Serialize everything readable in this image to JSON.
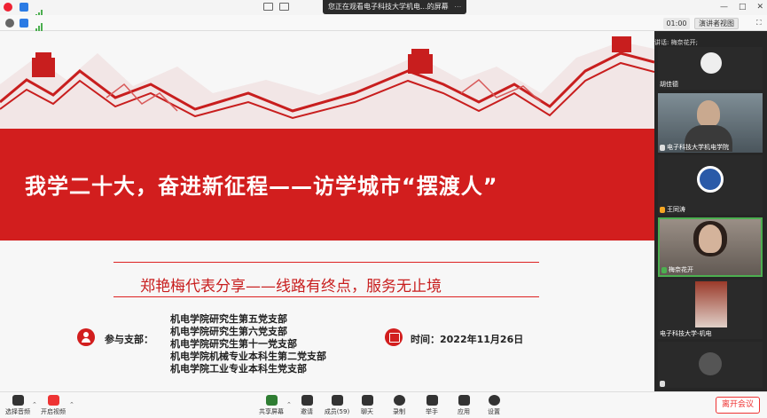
{
  "topbar": {
    "share_notice": "您正在观看电子科技大学机电...的屏幕",
    "dots": "⋯"
  },
  "toolbar": {
    "timer": "01:00",
    "view_mode": "演讲者视图"
  },
  "slide": {
    "title": "我学二十大，奋进新征程——访学城市“摆渡人”",
    "subtitle": "郑艳梅代表分享——线路有终点，服务无止境",
    "branch_label": "参与支部：",
    "branches": [
      "机电学院研究生第五党支部",
      "机电学院研究生第六党支部",
      "机电学院研究生第十一党支部",
      "机电学院机械专业本科生第二党支部",
      "机电学院工业专业本科生党支部"
    ],
    "time_label": "时间：2022年11月26日",
    "accent_color": "#d21e1e"
  },
  "panel": {
    "speaking_label": "讲话: 梅奈花开;",
    "tiles": [
      {
        "name": "胡佳德",
        "kind": "avatar"
      },
      {
        "name": "电子科技大学机电学院",
        "kind": "video"
      },
      {
        "name": "王同涛",
        "kind": "logo"
      },
      {
        "name": "梅奈花开",
        "kind": "video-active"
      },
      {
        "name": "电子科技大学-机电",
        "kind": "video"
      },
      {
        "name": "",
        "kind": "avatar"
      }
    ]
  },
  "bottombar": {
    "items": [
      {
        "label": "选择音频",
        "icon": "headphone-icon"
      },
      {
        "label": "开启视频",
        "icon": "video-off-icon"
      },
      {
        "label": "共享屏幕",
        "icon": "share-screen-icon"
      },
      {
        "label": "邀请",
        "icon": "invite-icon"
      },
      {
        "label": "成员(59)",
        "icon": "members-icon"
      },
      {
        "label": "聊天",
        "icon": "chat-icon"
      },
      {
        "label": "录制",
        "icon": "record-icon"
      },
      {
        "label": "举手",
        "icon": "raise-hand-icon"
      },
      {
        "label": "应用",
        "icon": "apps-icon"
      },
      {
        "label": "设置",
        "icon": "settings-icon"
      }
    ],
    "leave_label": "离开会议"
  }
}
